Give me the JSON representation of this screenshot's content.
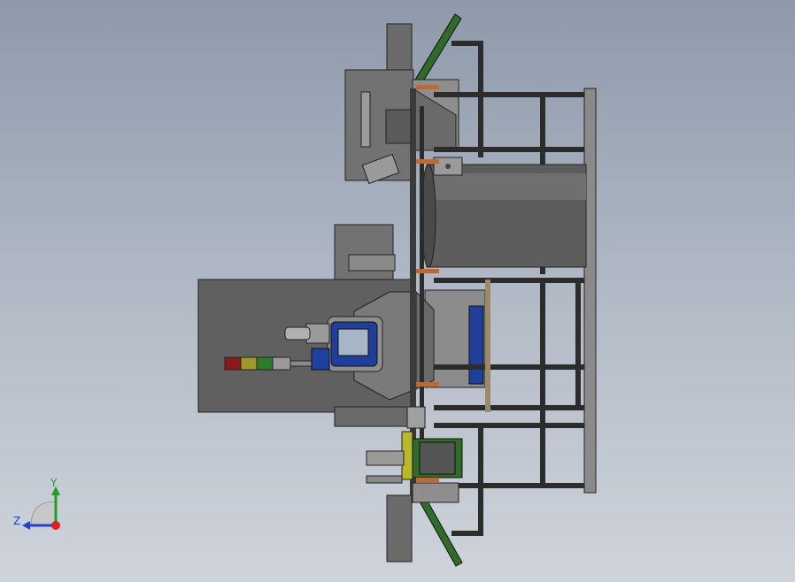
{
  "viewport": {
    "background_top": "#8e99aa",
    "background_bottom": "#cfd4db"
  },
  "model": {
    "frame_color": "#2c2c2c",
    "plate_color": "#6b6b6b",
    "drum_color": "#5d5d5d",
    "panel_color": "#606060",
    "hmi_screen_color": "#1f3f9a",
    "accent_green": "#2f6b2a",
    "accent_copper": "#b86a3a",
    "stack_light_colors": [
      "#8a1a1a",
      "#a09a2a",
      "#2f7a2f",
      "#9a9a9a"
    ]
  },
  "triad": {
    "y_label": "Y",
    "z_label": "Z",
    "y_color": "#20a020",
    "z_color": "#2040d0",
    "origin_color": "#e02020"
  }
}
